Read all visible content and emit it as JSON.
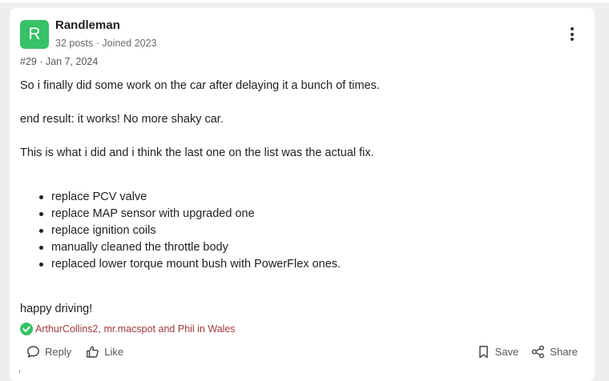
{
  "author": {
    "initial": "R",
    "name": "Randleman",
    "posts": "32 posts",
    "joined": "Joined 2023",
    "avatar_color": "#36c267"
  },
  "post": {
    "number": "#29",
    "date": "Jan 7, 2024",
    "para1": "So i finally did some work on the car after delaying it a bunch of times.",
    "para2": "end result: it works! No more shaky car.",
    "para3": "This is what i did and i think the last one on the list was the actual fix.",
    "fixes": [
      "replace PCV valve",
      "replace MAP sensor with upgraded one",
      "replace ignition coils",
      "manually cleaned the throttle body",
      "replaced lower torque mount bush with PowerFlex ones."
    ],
    "closing": "happy driving!"
  },
  "reactions": {
    "likers_text": "ArthurCollins2, mr.macspot and Phil in Wales",
    "check_color": "#36c267",
    "link_color": "#a03c3c"
  },
  "actions": {
    "reply": "Reply",
    "like": "Like",
    "save": "Save",
    "share": "Share"
  },
  "icons": {
    "menu": "more-vertical-icon",
    "reply": "speech-bubble-icon",
    "like": "thumbs-up-icon",
    "save": "bookmark-icon",
    "share": "share-icon",
    "reaction": "check-circle-icon"
  }
}
